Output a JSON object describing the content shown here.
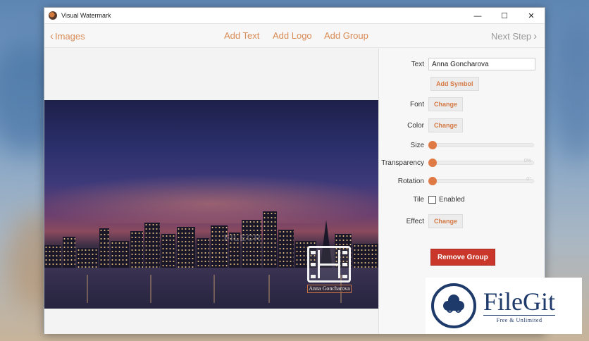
{
  "window": {
    "title": "Visual Watermark",
    "controls": {
      "minimize": "—",
      "maximize": "☐",
      "close": "✕"
    }
  },
  "toolbar": {
    "back_label": "Images",
    "add_text": "Add Text",
    "add_logo": "Add Logo",
    "add_group": "Add Group",
    "next_label": "Next Step",
    "accent_color": "#d98b55"
  },
  "preview": {
    "watermark_text": "Anna Goncharova",
    "watermark_logo_icon": "film-strip-icon",
    "ghost_watermark": "FILECR"
  },
  "panel": {
    "text_label": "Text",
    "text_value": "Anna Goncharova",
    "add_symbol": "Add Symbol",
    "font_label": "Font",
    "font_button": "Change",
    "color_label": "Color",
    "color_button": "Change",
    "size_label": "Size",
    "size_level": 0,
    "transparency_label": "Transparency",
    "transparency_level": 0,
    "transparency_value": "0%",
    "rotation_label": "Rotation",
    "rotation_level": 0,
    "rotation_value": "0°",
    "tile_label": "Tile",
    "tile_checkbox_label": "Enabled",
    "tile_enabled": false,
    "effect_label": "Effect",
    "effect_button": "Change",
    "remove_group": "Remove Group",
    "remove_color": "#c9372b"
  },
  "overlay_logo": {
    "name": "FileGit",
    "tagline": "Free & Unlimited",
    "color": "#1d3a6a"
  }
}
